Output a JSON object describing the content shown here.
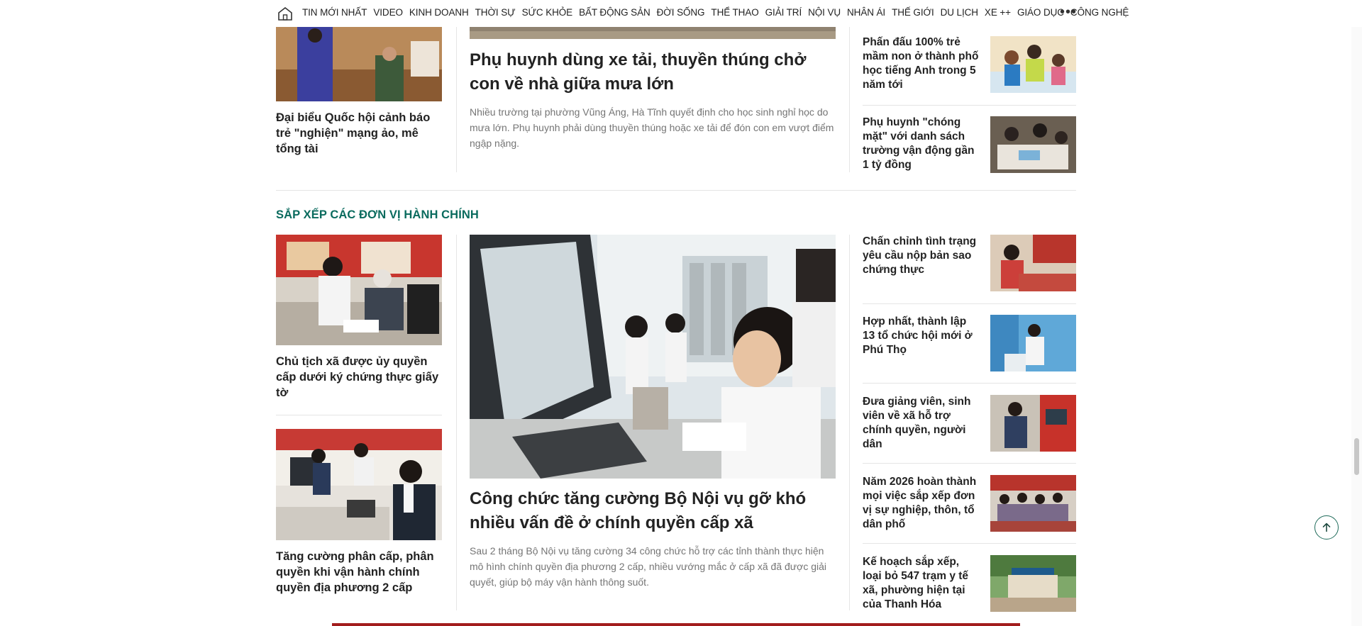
{
  "nav": {
    "items": [
      "TIN MỚI NHẤT",
      "VIDEO",
      "KINH DOANH",
      "THỜI SỰ",
      "SỨC KHỎE",
      "BẤT ĐỘNG SẢN",
      "ĐỜI SỐNG",
      "THỂ THAO",
      "GIẢI TRÍ",
      "NỘI VỤ",
      "NHÂN ÁI",
      "THẾ GIỚI",
      "DU LỊCH",
      "XE ++",
      "GIÁO DỤC",
      "CÔNG NGHỆ"
    ],
    "more": "•••"
  },
  "top": {
    "left_title": "Đại biểu Quốc hội cảnh báo trẻ \"nghiện\" mạng ảo, mê tổng tài",
    "center_title": "Phụ huynh dùng xe tải, thuyền thúng chở con về nhà giữa mưa lớn",
    "center_sapo": "Nhiều trường tại phường Vũng Áng, Hà Tĩnh quyết định cho học sinh nghỉ học do mưa lớn. Phụ huynh phải dùng thuyền thúng hoặc xe tải để đón con em vượt điểm ngập nặng.",
    "right": [
      {
        "title": "Phấn đấu 100% trẻ mầm non ở thành phố học tiếng Anh trong 5 năm tới"
      },
      {
        "title": "Phụ huynh \"chóng mặt\" với danh sách trường vận động gần 1 tỷ đồng"
      }
    ]
  },
  "section": {
    "title": "SẮP XẾP CÁC ĐƠN VỊ HÀNH CHÍNH",
    "left": [
      {
        "title": "Chủ tịch xã được ủy quyền cấp dưới ký chứng thực giấy tờ"
      },
      {
        "title": "Tăng cường phân cấp, phân quyền khi vận hành chính quyền địa phương 2 cấp"
      }
    ],
    "center_title": "Công chức tăng cường Bộ Nội vụ gỡ khó nhiều vấn đề ở chính quyền cấp xã",
    "center_sapo": "Sau 2 tháng Bộ Nội vụ tăng cường 34 công chức hỗ trợ các tỉnh thành thực hiện mô hình chính quyền địa phương 2 cấp, nhiều vướng mắc ở cấp xã đã được giải quyết, giúp bộ máy vận hành thông suốt.",
    "right": [
      {
        "title": "Chấn chỉnh tình trạng yêu cầu nộp bản sao chứng thực"
      },
      {
        "title": "Hợp nhất, thành lập 13 tổ chức hội mới ở Phú Thọ"
      },
      {
        "title": "Đưa giảng viên, sinh viên về xã hỗ trợ chính quyền, người dân"
      },
      {
        "title": "Năm 2026 hoàn thành mọi việc sắp xếp đơn vị sự nghiệp, thôn, tổ dân phố"
      },
      {
        "title": "Kế hoạch sắp xếp, loại bỏ 547 trạm y tế xã, phường hiện tại của Thanh Hóa"
      }
    ]
  }
}
